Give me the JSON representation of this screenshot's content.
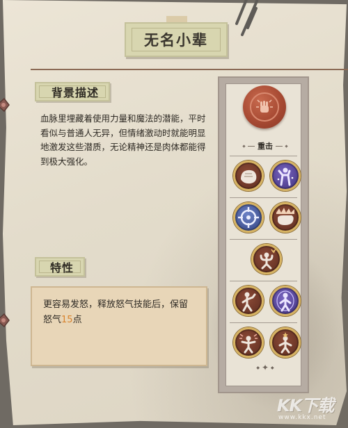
{
  "title": "无名小辈",
  "sections": {
    "background_label": "背景描述",
    "background_text": "血脉里埋藏着使用力量和魔法的潜能，平时看似与普通人无异，但情绪激动时就能明显地激发这些潜质，无论精神还是肉体都能得到极大强化。",
    "trait_label": "特性",
    "trait_text_before": "更容易发怒，释放怒气技能后，保留怒气",
    "trait_value": "15",
    "trait_text_after": "点"
  },
  "panel": {
    "seal_icon": "fist-burst-icon",
    "seal_label": "重击",
    "skill_icons": [
      "punch-fist-icon",
      "aura-figure-icon",
      "crosshair-target-icon",
      "gauntlet-smash-icon",
      "rage-flex-icon",
      "fighter-stance-icon",
      "spirit-figure-icon",
      "anger-burst-icon",
      "power-up-icon"
    ]
  },
  "watermark": {
    "text": "KK下载",
    "sub": "www.kkx.net"
  },
  "colors": {
    "paper": "#e3dccb",
    "tag_fill": "#d8d6b0",
    "trait_box": "#e8d6b8",
    "highlight": "#d8822c",
    "seal": "#a74a33",
    "skill_ring": "#d7b463",
    "divider": "#8b6a55"
  }
}
